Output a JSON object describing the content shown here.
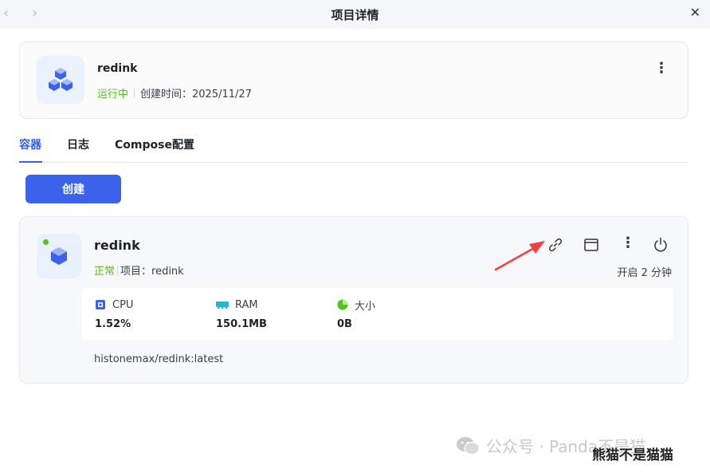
{
  "window": {
    "title": "项目详情",
    "back_icon": "‹",
    "forward_icon": "›",
    "close_icon": "✕"
  },
  "project": {
    "name": "redink",
    "status": "运行中",
    "created": "创建时间：2025/11/27",
    "more_icon": "⋮"
  },
  "tabs": [
    {
      "label": "容器",
      "active": true
    },
    {
      "label": "日志",
      "active": false
    },
    {
      "label": "Compose配置",
      "active": false
    }
  ],
  "create_button": {
    "label": "创建"
  },
  "container": {
    "name": "redink",
    "status": "正常",
    "project_label": "项目：redink",
    "uptime": "开启 2 分钟",
    "more_icon": "⋮",
    "stats": {
      "cpu": {
        "label": "CPU",
        "value": "1.52%"
      },
      "ram": {
        "label": "RAM",
        "value": "150.1MB"
      },
      "size": {
        "label": "大小",
        "value": "0B"
      }
    },
    "image": "histonemax/redink:latest"
  },
  "watermark": {
    "text": "公众号 · Panda不是猫",
    "overlay": "熊猫不是猫猫"
  },
  "colors": {
    "accent": "#3a62ea",
    "status_green": "#52c41a",
    "arrow_red": "#f04040"
  }
}
